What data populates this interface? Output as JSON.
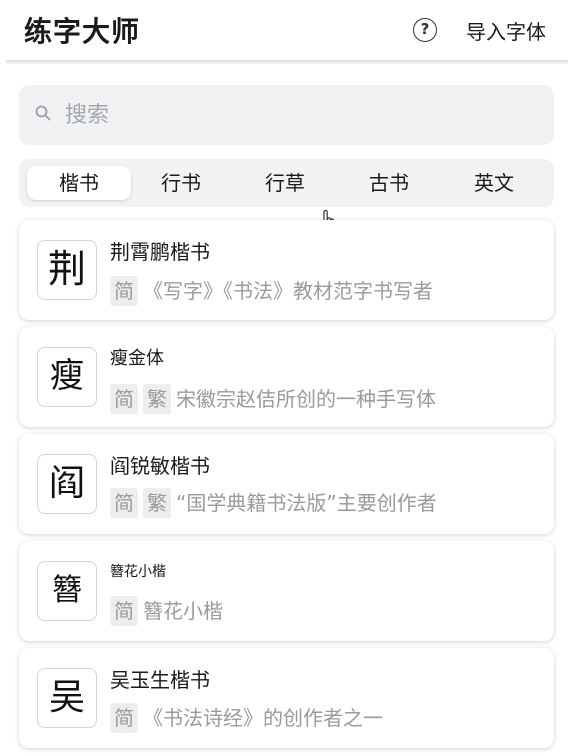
{
  "header": {
    "title": "练字大师",
    "help_icon": "question-circle-icon",
    "help_glyph": "?",
    "import_label": "导入字体"
  },
  "search": {
    "placeholder": "搜索",
    "icon": "search-icon",
    "value": ""
  },
  "tabs": [
    {
      "label": "楷书",
      "active": true
    },
    {
      "label": "行书",
      "active": false
    },
    {
      "label": "行草",
      "active": false
    },
    {
      "label": "古书",
      "active": false
    },
    {
      "label": "英文",
      "active": false
    }
  ],
  "fonts": [
    {
      "glyph": "荆",
      "name": "荆霄鹏楷书",
      "badges": [
        "简"
      ],
      "description": "《写字》《书法》教材范字书写者"
    },
    {
      "glyph": "瘦",
      "name": "瘦金体",
      "badges": [
        "简",
        "繁"
      ],
      "description": "宋徽宗赵佶所创的一种手写体"
    },
    {
      "glyph": "阎",
      "name": "阎锐敏楷书",
      "badges": [
        "简",
        "繁"
      ],
      "description": "“国学典籍书法版”主要创作者"
    },
    {
      "glyph": "簪",
      "name": "簪花小楷",
      "badges": [
        "简"
      ],
      "description": "簪花小楷"
    },
    {
      "glyph": "吴",
      "name": "吴玉生楷书",
      "badges": [
        "简"
      ],
      "description": "《书法诗经》的创作者之一"
    }
  ],
  "colors": {
    "accent_bg": "#f0f2f4",
    "muted_text": "#9a9a9a",
    "badge_bg": "#ededed"
  }
}
